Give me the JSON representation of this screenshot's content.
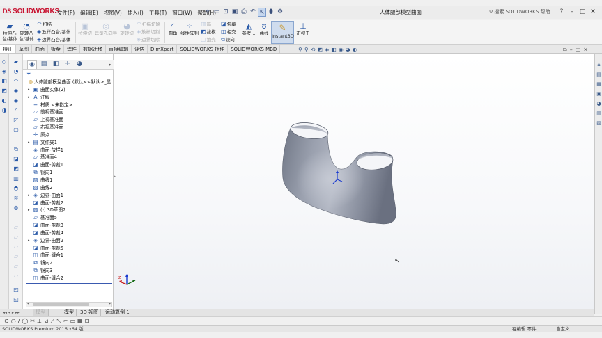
{
  "app": {
    "brand": "SOLIDWORKS",
    "brand_mark": "DS",
    "document_title": "人体腿部模型曲面",
    "help_search_placeholder": "搜索 SOLIDWORKS 帮助"
  },
  "menu": [
    "文件(F)",
    "编辑(E)",
    "视图(V)",
    "插入(I)",
    "工具(T)",
    "窗口(W)",
    "帮助(H)"
  ],
  "quick_tools": [
    "pin-icon",
    "new-icon",
    "open-icon",
    "save-icon",
    "print-icon",
    "undo-icon",
    "select-icon",
    "rebuild-icon",
    "options-icon"
  ],
  "window_controls": [
    "?",
    "–",
    "□",
    "✕"
  ],
  "ribbon": {
    "extrude_boss": [
      "拉伸凸",
      "台/基体"
    ],
    "revolve_boss": [
      "旋转凸",
      "台/基体"
    ],
    "sweep": "扫描",
    "loft_boss": "放样凸台/基体",
    "boundary_boss": "边界凸台/基体",
    "extrude_cut": "拉伸切",
    "hole_wizard": "异型孔向导",
    "revolve_cut": "旋转切",
    "swept_cut": "扫描切除",
    "lofted_cut": "放样切割",
    "boundary_cut": "边界切除",
    "fillet": "圆角",
    "linear_pattern": "线性阵列",
    "rib": "筋",
    "draft": "拔模",
    "shell": "抽壳",
    "wrap": "包覆",
    "intersect": "相交",
    "mirror": "镜向",
    "reference_geometry": "参考...",
    "curves": "曲线",
    "instant3d": "Instant3D",
    "normal_to": "正视于"
  },
  "command_tabs": [
    "特征",
    "草图",
    "曲面",
    "钣金",
    "焊件",
    "数据迁移",
    "直接编辑",
    "评估",
    "DimXpert",
    "SOLIDWORKS 插件",
    "SOLIDWORKS MBD"
  ],
  "active_command_tab": "特征",
  "hud_icons": [
    "zoom-fit-icon",
    "zoom-area-icon",
    "previous-view-icon",
    "section-view-icon",
    "view-orientation-icon",
    "display-style-icon",
    "hide-show-icon",
    "appearance-icon",
    "scene-icon",
    "view-settings-icon"
  ],
  "feature_tree": {
    "root": "人体腿部模型曲面 (默认<<默认>_显",
    "items": [
      {
        "label": "曲面实体(2)",
        "icon": "surface-bodies-icon",
        "exp": "▸"
      },
      {
        "label": "注解",
        "icon": "annotations-icon",
        "exp": "▸"
      },
      {
        "label": "材质 <未指定>",
        "icon": "material-icon",
        "exp": ""
      },
      {
        "label": "前视基准面",
        "icon": "plane-icon",
        "exp": ""
      },
      {
        "label": "上视基准面",
        "icon": "plane-icon",
        "exp": ""
      },
      {
        "label": "右视基准面",
        "icon": "plane-icon",
        "exp": ""
      },
      {
        "label": "原点",
        "icon": "origin-icon",
        "exp": ""
      },
      {
        "label": "文件夹1",
        "icon": "folder-icon",
        "exp": "▸"
      },
      {
        "label": "曲面-放样1",
        "icon": "surface-loft-icon",
        "exp": ""
      },
      {
        "label": "基准面4",
        "icon": "plane-icon",
        "exp": ""
      },
      {
        "label": "曲面-剪裁1",
        "icon": "surface-trim-icon",
        "exp": ""
      },
      {
        "label": "镜向1",
        "icon": "mirror-icon",
        "exp": ""
      },
      {
        "label": "曲线1",
        "icon": "curve-icon",
        "exp": ""
      },
      {
        "label": "曲线2",
        "icon": "curve-icon",
        "exp": ""
      },
      {
        "label": "边界-曲面1",
        "icon": "boundary-surface-icon",
        "exp": "▸"
      },
      {
        "label": "曲面-剪裁2",
        "icon": "surface-trim-icon",
        "exp": ""
      },
      {
        "label": "(-) 3D草图2",
        "icon": "sketch-3d-icon",
        "exp": "▸"
      },
      {
        "label": "基准面5",
        "icon": "plane-icon",
        "exp": ""
      },
      {
        "label": "曲面-剪裁3",
        "icon": "surface-trim-icon",
        "exp": ""
      },
      {
        "label": "曲面-剪裁4",
        "icon": "surface-trim-icon",
        "exp": ""
      },
      {
        "label": "边界-曲面2",
        "icon": "boundary-surface-icon",
        "exp": "▸"
      },
      {
        "label": "曲面-剪裁5",
        "icon": "surface-trim-icon",
        "exp": ""
      },
      {
        "label": "曲面-缝合1",
        "icon": "surface-knit-icon",
        "exp": ""
      },
      {
        "label": "镜向2",
        "icon": "mirror-icon",
        "exp": ""
      },
      {
        "label": "镜向3",
        "icon": "mirror-icon",
        "exp": ""
      },
      {
        "label": "曲面-缝合2",
        "icon": "surface-knit-icon",
        "exp": ""
      }
    ]
  },
  "bottom_tabs": {
    "ghost": "模型",
    "model": "模型",
    "view3d": "3D 视图",
    "motion": "运动算例 1"
  },
  "statusbar": {
    "left": "SOLIDWORKS Premium 2016 x64 版",
    "mid": "在编辑 零件",
    "right": "自定义"
  },
  "colors": {
    "brand": "#c8102e",
    "surface": "#8f96a6",
    "accent": "#2a5aa8"
  }
}
